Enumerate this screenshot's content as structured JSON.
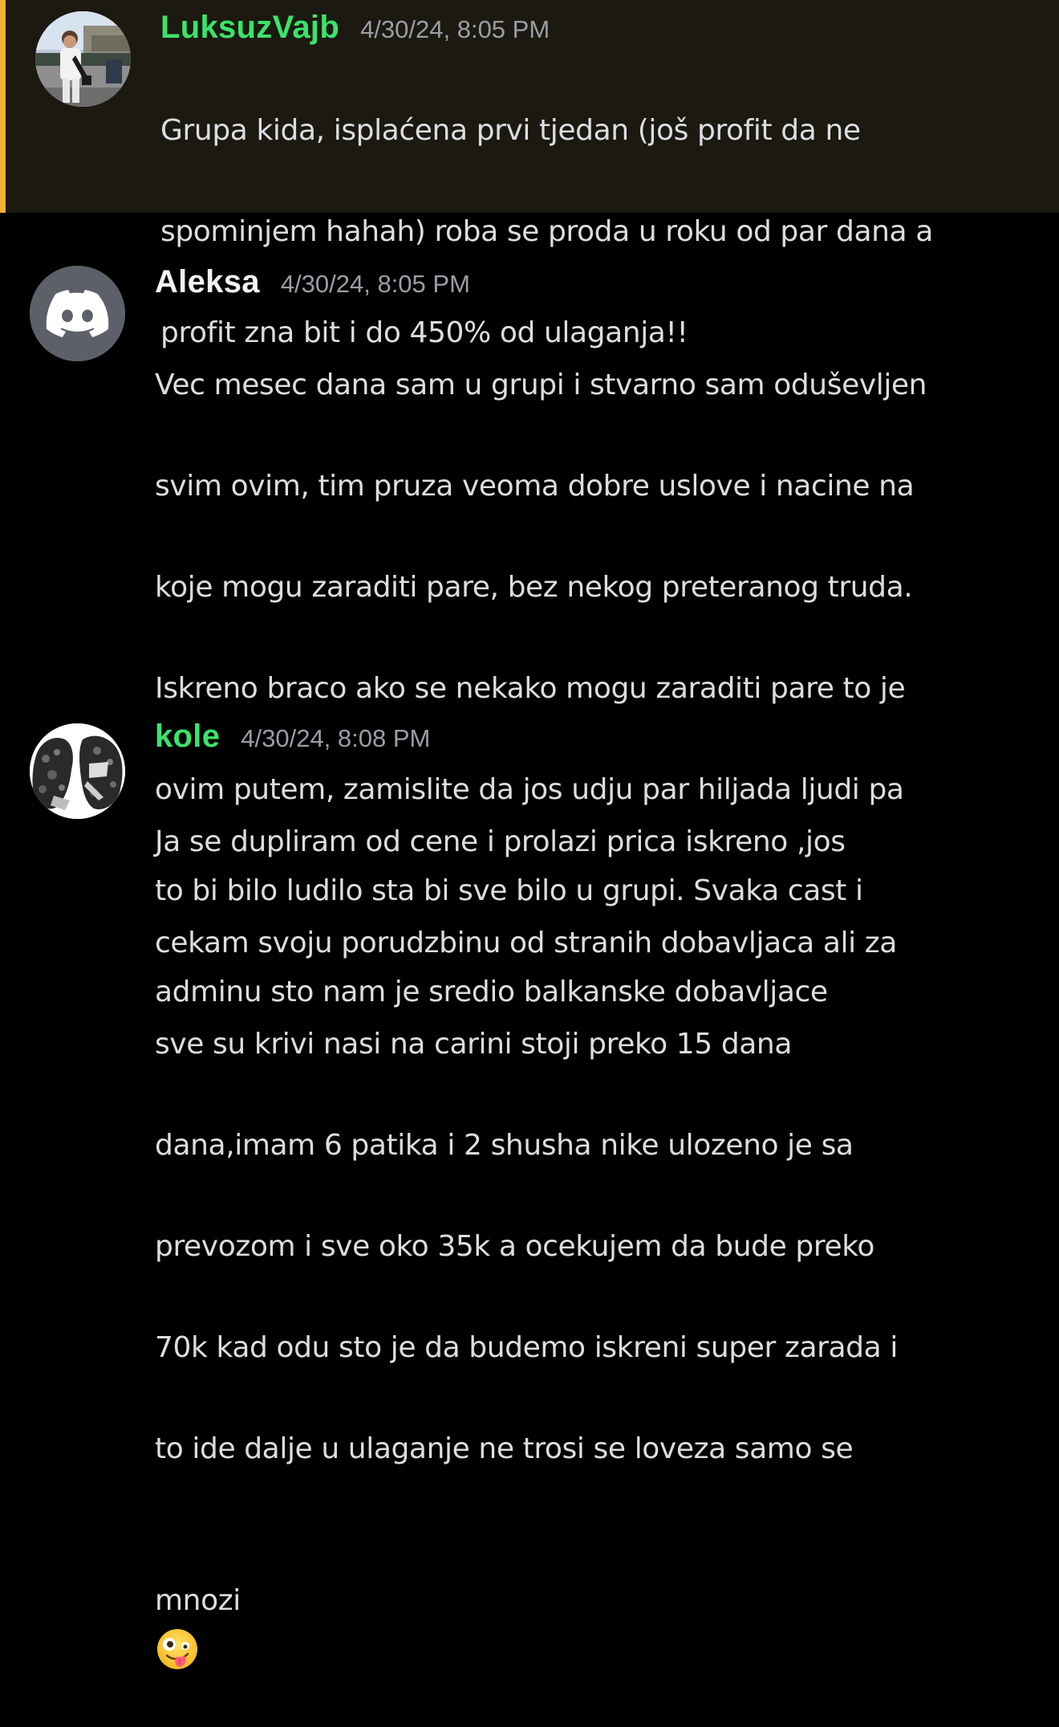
{
  "messages": [
    {
      "username": "LuksuzVajb",
      "username_color": "#3be36b",
      "timestamp": "4/30/24, 8:05 PM",
      "highlighted": true,
      "avatar": "photo-avatar",
      "lines": [
        "Grupa kida, isplaćena prvi tjedan (još profit da ne",
        "spominjem hahah) roba se proda u roku od par dana a",
        "profit zna bit i do 450% od ulaganja!!"
      ]
    },
    {
      "username": "Aleksa",
      "username_color": "#f2f3f5",
      "timestamp": "4/30/24, 8:05 PM",
      "highlighted": false,
      "avatar": "discord-default-avatar",
      "lines": [
        "Vec mesec dana sam u grupi i stvarno sam oduševljen",
        "svim ovim,  tim pruza veoma dobre uslove i nacine na",
        "koje mogu zaraditi pare, bez nekog preteranog truda.",
        "Iskreno braco ako se nekako mogu zaraditi pare to je",
        "ovim putem, zamislite da jos udju par hiljada ljudi pa",
        "to bi bilo ludilo sta bi sve bilo u grupi. Svaka cast i",
        "adminu sto nam je sredio balkanske dobavljace"
      ]
    },
    {
      "username": "kole",
      "username_color": "#3be36b",
      "timestamp": "4/30/24, 8:08 PM",
      "highlighted": false,
      "avatar": "hoodie-avatar",
      "lines": [
        "Ja se dupliram od cene i prolazi prica iskreno ,jos",
        "cekam svoju porudzbinu od stranih dobavljaca ali za",
        "sve su krivi nasi na carini stoji preko 15 dana",
        "dana,imam 6 patika i 2 shusha nike ulozeno je sa",
        "prevozom i sve oko 35k a ocekujem da bude preko",
        "70k kad odu sto je da budemo iskreni super zarada i",
        "to ide dalje u ulaganje ne trosi se loveza samo se",
        "mnozi"
      ],
      "trailing_emoji": "zany-face-emoji"
    }
  ],
  "colors": {
    "background": "#000000",
    "highlight_bg": "#1c1910",
    "highlight_bar": "#f0b232",
    "text": "#dbdee1",
    "timestamp": "#9a9ea6",
    "discord_avatar_bg": "#5d6069"
  }
}
